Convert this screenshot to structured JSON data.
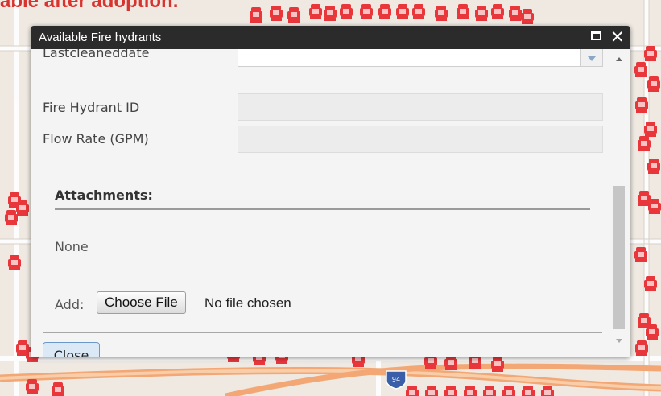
{
  "caption": "able after adoption.",
  "popup": {
    "title": "Available Fire hydrants",
    "fields": [
      {
        "label": "Lastcleaneddate",
        "value": ""
      },
      {
        "label": "Fire Hydrant ID",
        "value": ""
      },
      {
        "label": "Flow Rate (GPM)",
        "value": ""
      }
    ],
    "attachments": {
      "heading": "Attachments:",
      "none": "None",
      "add_label": "Add:",
      "choose_file": "Choose File",
      "no_file": "No file chosen"
    },
    "close_label": "Close"
  },
  "map": {
    "road_shield": "94",
    "colors": {
      "hydrant": "#e8363b",
      "caption": "#d8342f",
      "road": "#f2a774",
      "titlebar": "#2b2b2b"
    }
  },
  "icons": [
    "fire-hydrant-icon",
    "maximize-icon",
    "close-icon",
    "scroll-up-arrow",
    "scroll-down-arrow",
    "dropdown-arrow"
  ]
}
